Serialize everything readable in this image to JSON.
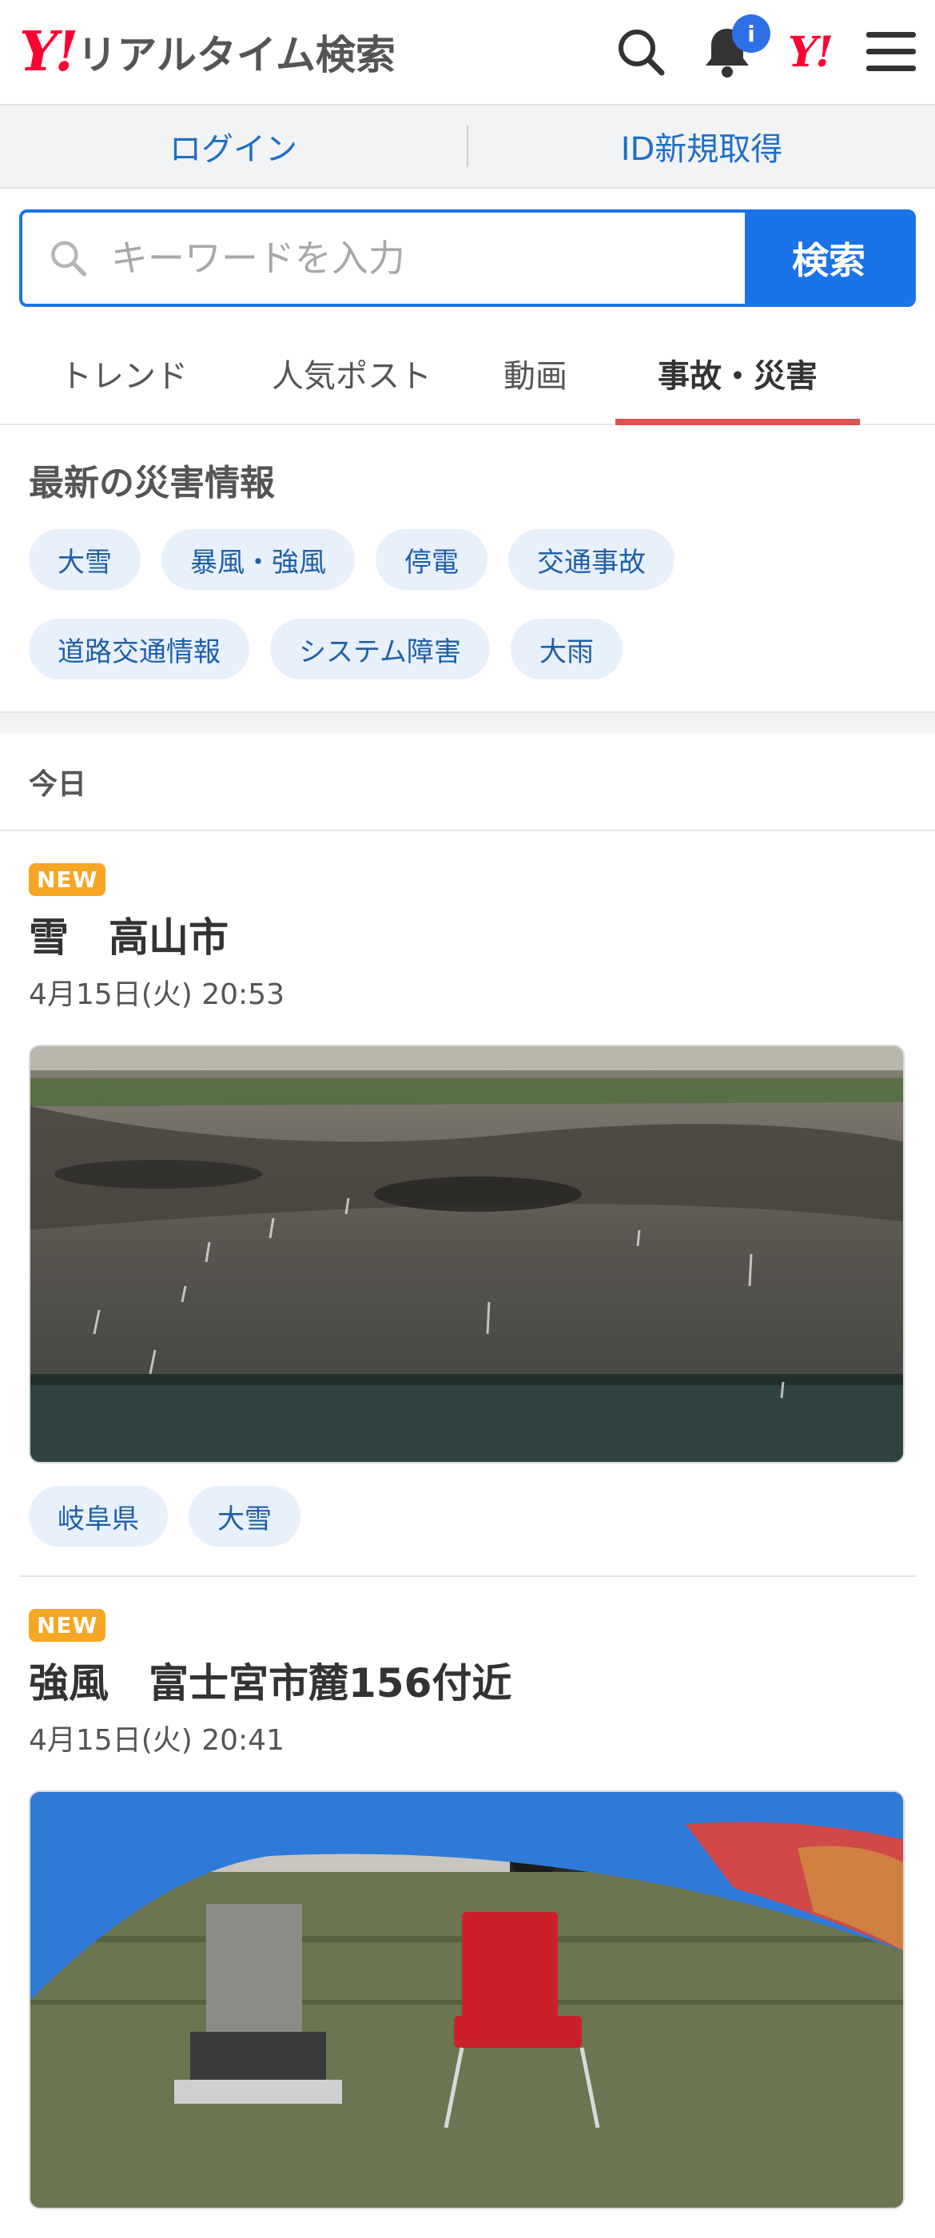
{
  "header": {
    "logo_mark": "Y!",
    "logo_text": "リアルタイム検索",
    "notification_badge": "i",
    "yahoo_mark": "Y!"
  },
  "auth": {
    "login": "ログイン",
    "register": "ID新規取得"
  },
  "search": {
    "placeholder": "キーワードを入力",
    "button": "検索"
  },
  "tabs": [
    {
      "label": "トレンド"
    },
    {
      "label": "人気ポスト"
    },
    {
      "label": "動画"
    },
    {
      "label": "事故・災害",
      "active": true
    }
  ],
  "disaster": {
    "title": "最新の災害情報",
    "chips": [
      "大雪",
      "暴風・強風",
      "停電",
      "交通事故",
      "道路交通情報",
      "システム障害",
      "大雨"
    ]
  },
  "feed": {
    "day_label": "今日",
    "articles": [
      {
        "badge": "NEW",
        "title": "雪　高山市",
        "time": "4月15日(火) 20:53",
        "tags": [
          "岐阜県",
          "大雪"
        ]
      },
      {
        "badge": "NEW",
        "title": "強風　富士宮市麓156付近",
        "time": "4月15日(火) 20:41"
      }
    ]
  },
  "colors": {
    "brand_red": "#ff0033",
    "accent_blue": "#1a73e8",
    "tab_underline": "#e15151",
    "new_badge": "#f5a623"
  }
}
